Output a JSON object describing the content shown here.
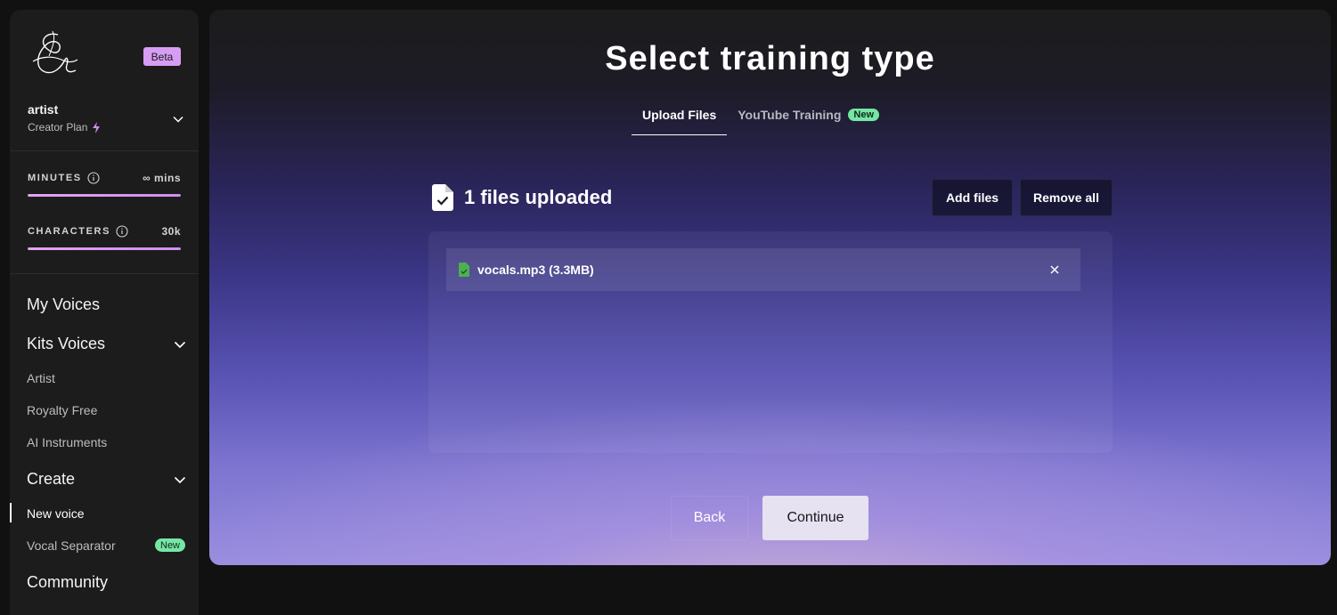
{
  "sidebar": {
    "beta_label": "Beta",
    "user": {
      "name": "artist",
      "plan": "Creator Plan"
    },
    "meters": [
      {
        "label": "MINUTES",
        "value": "∞ mins",
        "fill_fraction": 1.0
      },
      {
        "label": "CHARACTERS",
        "value": "30k",
        "fill_fraction": 1.0
      }
    ],
    "sections": {
      "my_voices": "My Voices",
      "kits_voices": "Kits Voices",
      "create": "Create",
      "community": "Community"
    },
    "items": {
      "artist": "Artist",
      "royalty_free": "Royalty Free",
      "ai_instruments": "AI Instruments",
      "new_voice": "New voice",
      "vocal_separator": "Vocal Separator",
      "vocal_separator_badge": "New"
    }
  },
  "main": {
    "title": "Select training type",
    "tabs": [
      {
        "label": "Upload Files",
        "selected": true
      },
      {
        "label": "YouTube Training",
        "badge": "New",
        "selected": false
      }
    ],
    "upload": {
      "count_text": "1 files uploaded",
      "add_files_label": "Add files",
      "remove_all_label": "Remove all",
      "files": [
        {
          "name": "vocals.mp3 (3.3MB)"
        }
      ]
    },
    "back_label": "Back",
    "continue_label": "Continue"
  },
  "colors": {
    "beta_badge": "#d79df2",
    "new_badge": "#75e6a4",
    "meter_fill": "#e3a4f2",
    "file_icon": "#4caf50"
  }
}
